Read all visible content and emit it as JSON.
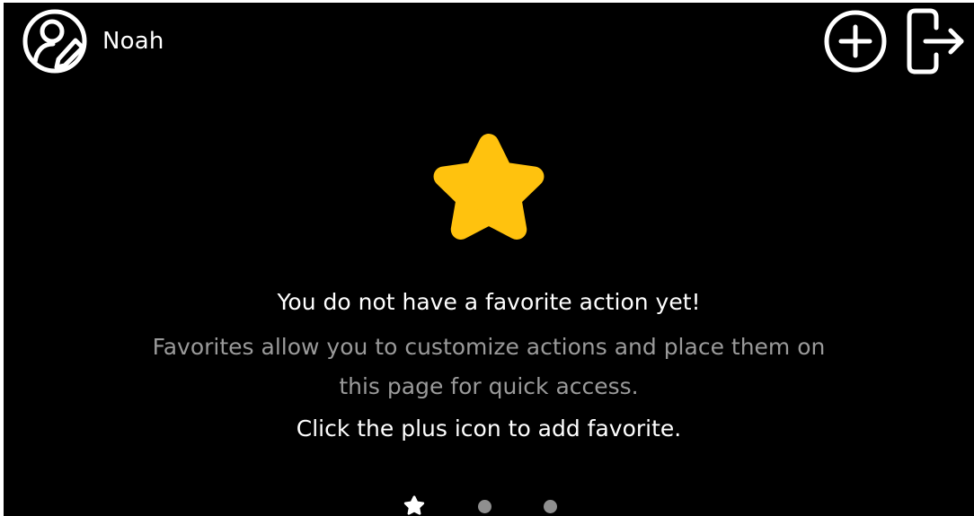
{
  "header": {
    "user_name": "Noah",
    "user_icon": "user-edit-icon",
    "actions": [
      {
        "name": "add",
        "icon": "plus-circle-icon"
      },
      {
        "name": "logout",
        "icon": "logout-icon"
      }
    ]
  },
  "empty_state": {
    "icon": "star-icon",
    "title": "You do not have a favorite action yet!",
    "description": "Favorites allow you to customize actions and place them on this page for quick access.",
    "hint": "Click the plus icon to add favorite."
  },
  "pager": {
    "pages": 3,
    "current_page": 1,
    "first_page_icon": "star-icon"
  },
  "colors": {
    "background": "#000000",
    "accent_star": "#FFC20E",
    "text_primary": "#FFFFFF",
    "text_secondary": "#9A9A9A",
    "pager_dot": "#8F8F8F"
  }
}
